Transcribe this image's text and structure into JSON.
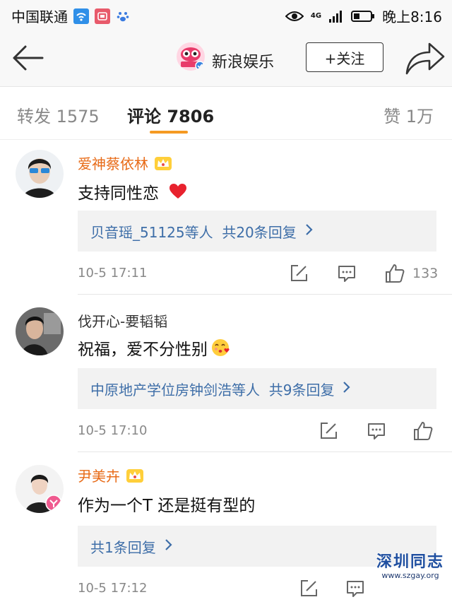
{
  "status_bar": {
    "carrier": "中国联通",
    "network": "4G",
    "time": "晚上8:16"
  },
  "nav": {
    "title": "新浪娱乐",
    "follow_label": "+关注"
  },
  "tabs": [
    {
      "label": "转发 1575"
    },
    {
      "label": "评论 7806"
    },
    {
      "label": "赞 1万"
    }
  ],
  "accent_color": "#f59a23",
  "comments": [
    {
      "user": "爱神蔡依林",
      "text": "支持同性恋",
      "reply_summary": "贝音瑶_51125等人  共20条回复",
      "time": "10-5 17:11",
      "likes": "133"
    },
    {
      "user": "伐开心-要韬韬",
      "text": "祝福，爱不分性别",
      "reply_summary": "中原地产学位房钟剑浩等人  共9条回复",
      "time": "10-5 17:10",
      "likes": ""
    },
    {
      "user": "尹美卉",
      "text": "作为一个T 还是挺有型的",
      "reply_summary": "共1条回复",
      "time": "10-5 17:12",
      "likes": ""
    }
  ],
  "watermark": {
    "title": "深圳同志",
    "url": "www.szgay.org"
  }
}
